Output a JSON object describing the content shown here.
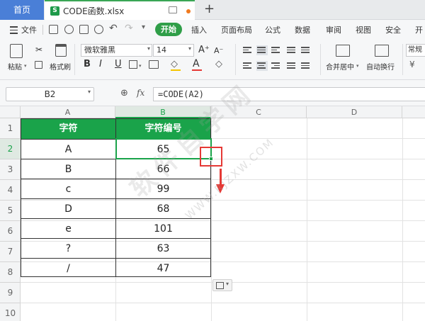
{
  "tabs": {
    "home": "首页",
    "file": "CODE函数.xlsx",
    "file_icon": "S"
  },
  "menu": {
    "file": "文件",
    "items": [
      "开始",
      "插入",
      "页面布局",
      "公式",
      "数据",
      "审阅",
      "视图",
      "安全",
      "开"
    ]
  },
  "ribbon": {
    "paste": "粘贴",
    "format_painter": "格式刷",
    "font_name": "微软雅黑",
    "font_size": "14",
    "grow": "A⁺",
    "shrink": "A⁻",
    "merge": "合并居中",
    "wrap": "自动换行",
    "number_format": "常规",
    "bold": "B",
    "italic": "I",
    "underline": "U"
  },
  "formula_bar": {
    "name_box": "B2",
    "fx": "fx",
    "formula": "=CODE(A2)"
  },
  "columns": [
    "A",
    "B",
    "C",
    "D"
  ],
  "rows": [
    "1",
    "2",
    "3",
    "4",
    "5",
    "6",
    "7",
    "8",
    "9",
    "10"
  ],
  "table": {
    "header": [
      "字符",
      "字符编号"
    ],
    "data": [
      [
        "A",
        "65"
      ],
      [
        "B",
        "66"
      ],
      [
        "c",
        "99"
      ],
      [
        "D",
        "68"
      ],
      [
        "e",
        "101"
      ],
      [
        "?",
        "63"
      ],
      [
        "/",
        "47"
      ]
    ]
  },
  "watermark": {
    "main": "软件自学网",
    "sub": "WWW.RJZXW.COM"
  },
  "colors": {
    "accent": "#1aa34a",
    "home_tab": "#4a7fd7",
    "annotation": "#e53935"
  }
}
